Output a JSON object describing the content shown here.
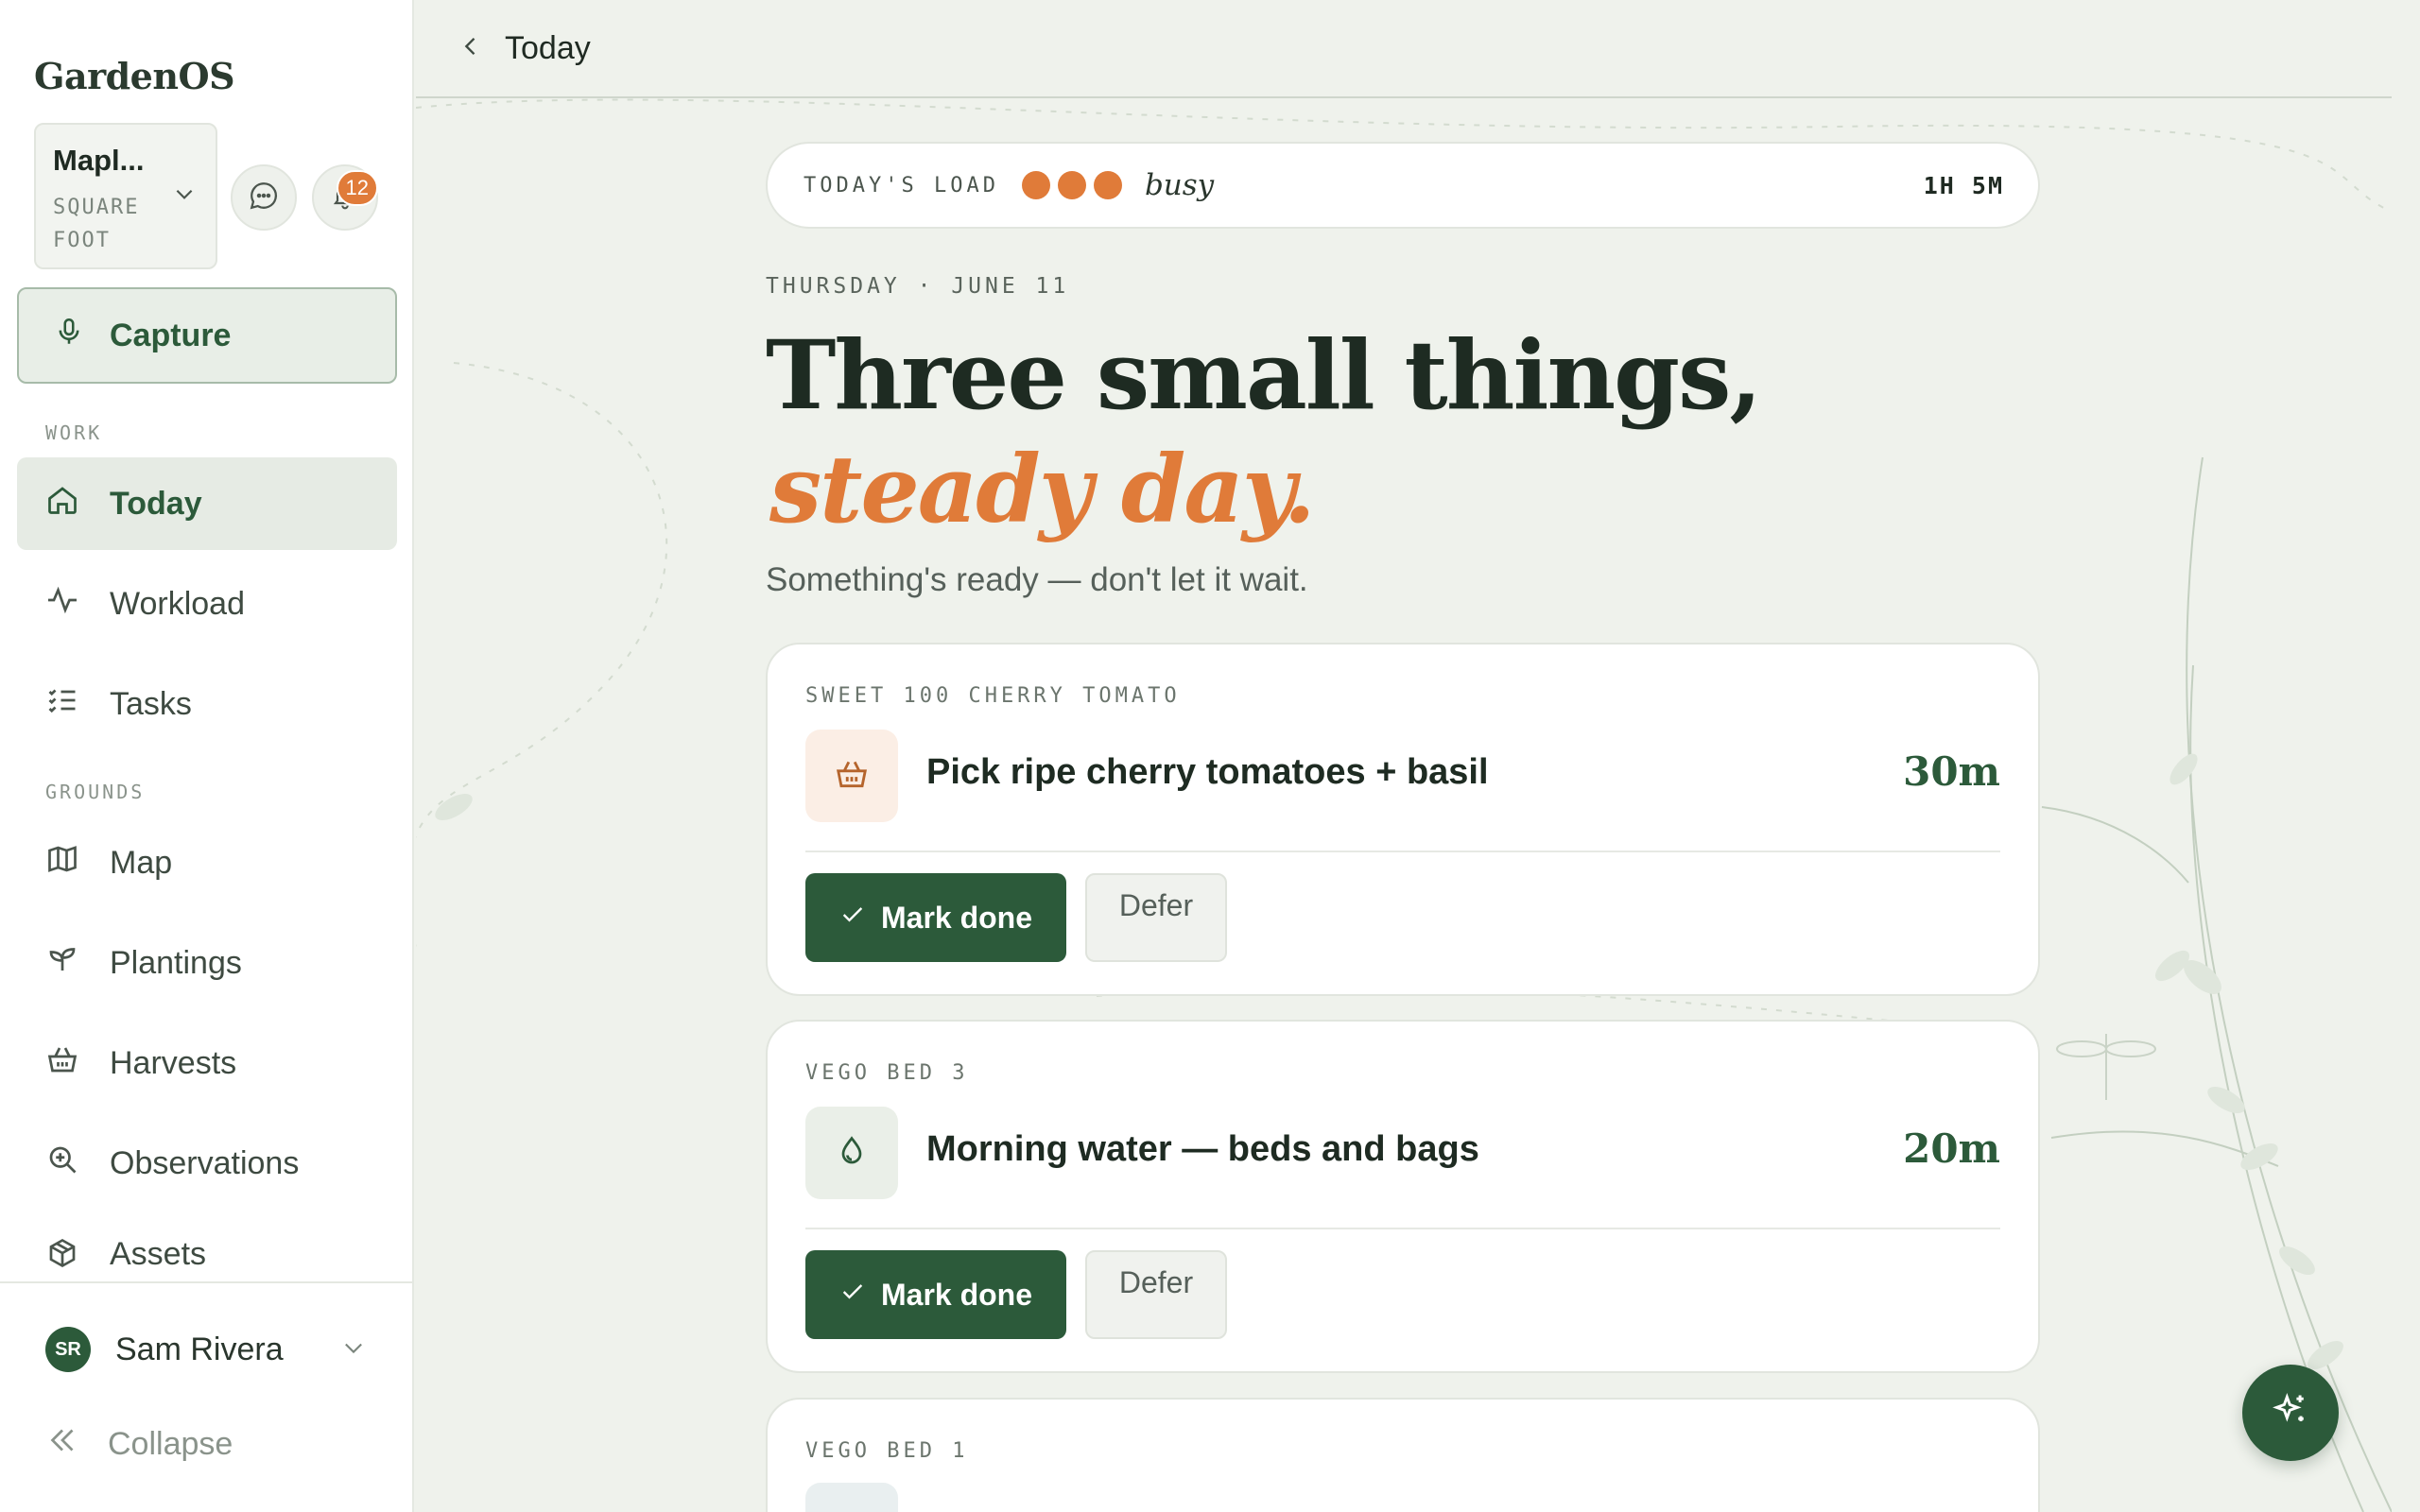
{
  "app": {
    "brand": "GardenOS"
  },
  "workspace": {
    "name": "Mapl...",
    "type": "SQUARE FOOT"
  },
  "notifications": {
    "count": "12"
  },
  "capture": {
    "label": "Capture"
  },
  "nav": {
    "work_label": "WORK",
    "grounds_label": "GROUNDS",
    "items": [
      {
        "label": "Today",
        "icon": "home-icon",
        "active": true
      },
      {
        "label": "Workload",
        "icon": "activity-icon"
      },
      {
        "label": "Tasks",
        "icon": "checklist-icon"
      },
      {
        "label": "Map",
        "icon": "map-icon"
      },
      {
        "label": "Plantings",
        "icon": "sprout-icon"
      },
      {
        "label": "Harvests",
        "icon": "basket-icon"
      },
      {
        "label": "Observations",
        "icon": "magnify-plus-icon"
      },
      {
        "label": "Assets",
        "icon": "box-icon"
      }
    ]
  },
  "user": {
    "initials": "SR",
    "name": "Sam Rivera"
  },
  "collapse": {
    "label": "Collapse"
  },
  "header": {
    "title": "Today"
  },
  "load": {
    "label": "TODAY'S LOAD",
    "level": 3,
    "word": "busy",
    "time": "1H 5M"
  },
  "day": {
    "date": "THURSDAY · JUNE 11",
    "headline": "Three small things,",
    "headline_accent": "steady day.",
    "subline": "Something's ready — don't let it wait."
  },
  "tasks": [
    {
      "location": "SWEET 100 CHERRY TOMATO",
      "title": "Pick ripe cherry tomatoes + basil",
      "duration": "30m",
      "icon": "basket-icon",
      "icon_bg": "#fbeee5",
      "icon_color": "#b5642c",
      "done_label": "Mark done",
      "defer_label": "Defer"
    },
    {
      "location": "VEGO BED 3",
      "title": "Morning water — beds and bags",
      "duration": "20m",
      "icon": "droplet-icon",
      "icon_bg": "#eaefe8",
      "icon_color": "#2c5a3a",
      "done_label": "Mark done",
      "defer_label": "Defer"
    },
    {
      "location": "VEGO BED 1",
      "title": "",
      "duration": "",
      "icon": "",
      "icon_bg": "#e9eff0"
    }
  ],
  "colors": {
    "accent": "#e07b39",
    "primary": "#2c5a3a",
    "background": "#eff2ec"
  }
}
